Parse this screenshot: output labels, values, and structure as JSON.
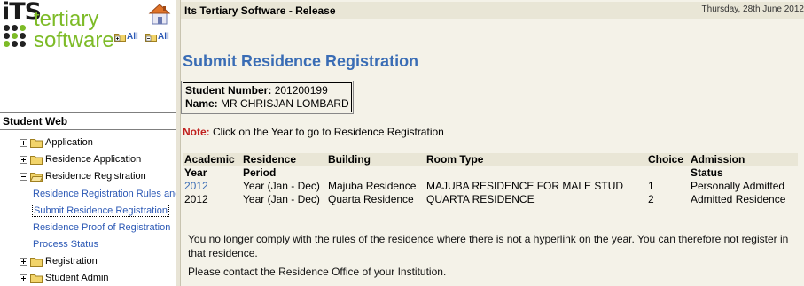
{
  "logo": {
    "its": "iTS",
    "line1": "tertiary",
    "line2": "software"
  },
  "toolbar": {
    "expand_all": "All",
    "collapse_all": "All"
  },
  "left": {
    "section_title": "Student Web",
    "tree": [
      {
        "label": "Application",
        "expanded": false
      },
      {
        "label": "Residence Application",
        "expanded": false
      },
      {
        "label": "Residence Registration",
        "expanded": true,
        "children": [
          "Residence Registration Rules and",
          "Submit Residence Registration",
          "Residence Proof of Registration",
          "Process Status"
        ]
      },
      {
        "label": "Registration",
        "expanded": false
      },
      {
        "label": "Student Admin",
        "expanded": false
      }
    ]
  },
  "header": {
    "app_title": "Its Tertiary Software - Release",
    "date": "Thursday, 28th June 2012"
  },
  "main": {
    "page_title": "Submit Residence Registration",
    "student": {
      "number_label": "Student Number:",
      "number": "201200199",
      "name_label": "Name:",
      "name": "MR CHRISJAN LOMBARD"
    },
    "note": {
      "label": "Note:",
      "text": " Click on the Year to go to Residence Registration"
    },
    "table": {
      "headers_row1": [
        "Academic",
        "Residence",
        "Building",
        "Room Type",
        "Choice",
        "Admission"
      ],
      "headers_row2": [
        "Year",
        "Period",
        "",
        "",
        "",
        "Status"
      ],
      "rows": [
        {
          "year": "2012",
          "link": true,
          "period": "Year (Jan - Dec)",
          "building": "Majuba Residence",
          "room_type": "MAJUBA RESIDENCE FOR MALE STUD",
          "choice": "1",
          "status": "Personally Admitted"
        },
        {
          "year": "2012",
          "link": false,
          "period": "Year (Jan - Dec)",
          "building": "Quarta Residence",
          "room_type": "QUARTA RESIDENCE",
          "choice": "2",
          "status": "Admitted Residence"
        }
      ]
    },
    "message1": "You no longer comply with the rules of the residence where there is not a hyperlink on the year. You can therefore not register in that residence.",
    "message2": "Please contact the Residence Office of your Institution."
  },
  "colors": {
    "accent_blue": "#3a6db5",
    "note_red": "#c0201e",
    "logo_green": "#7dbb27",
    "panel_bg": "#f4f2e8"
  }
}
